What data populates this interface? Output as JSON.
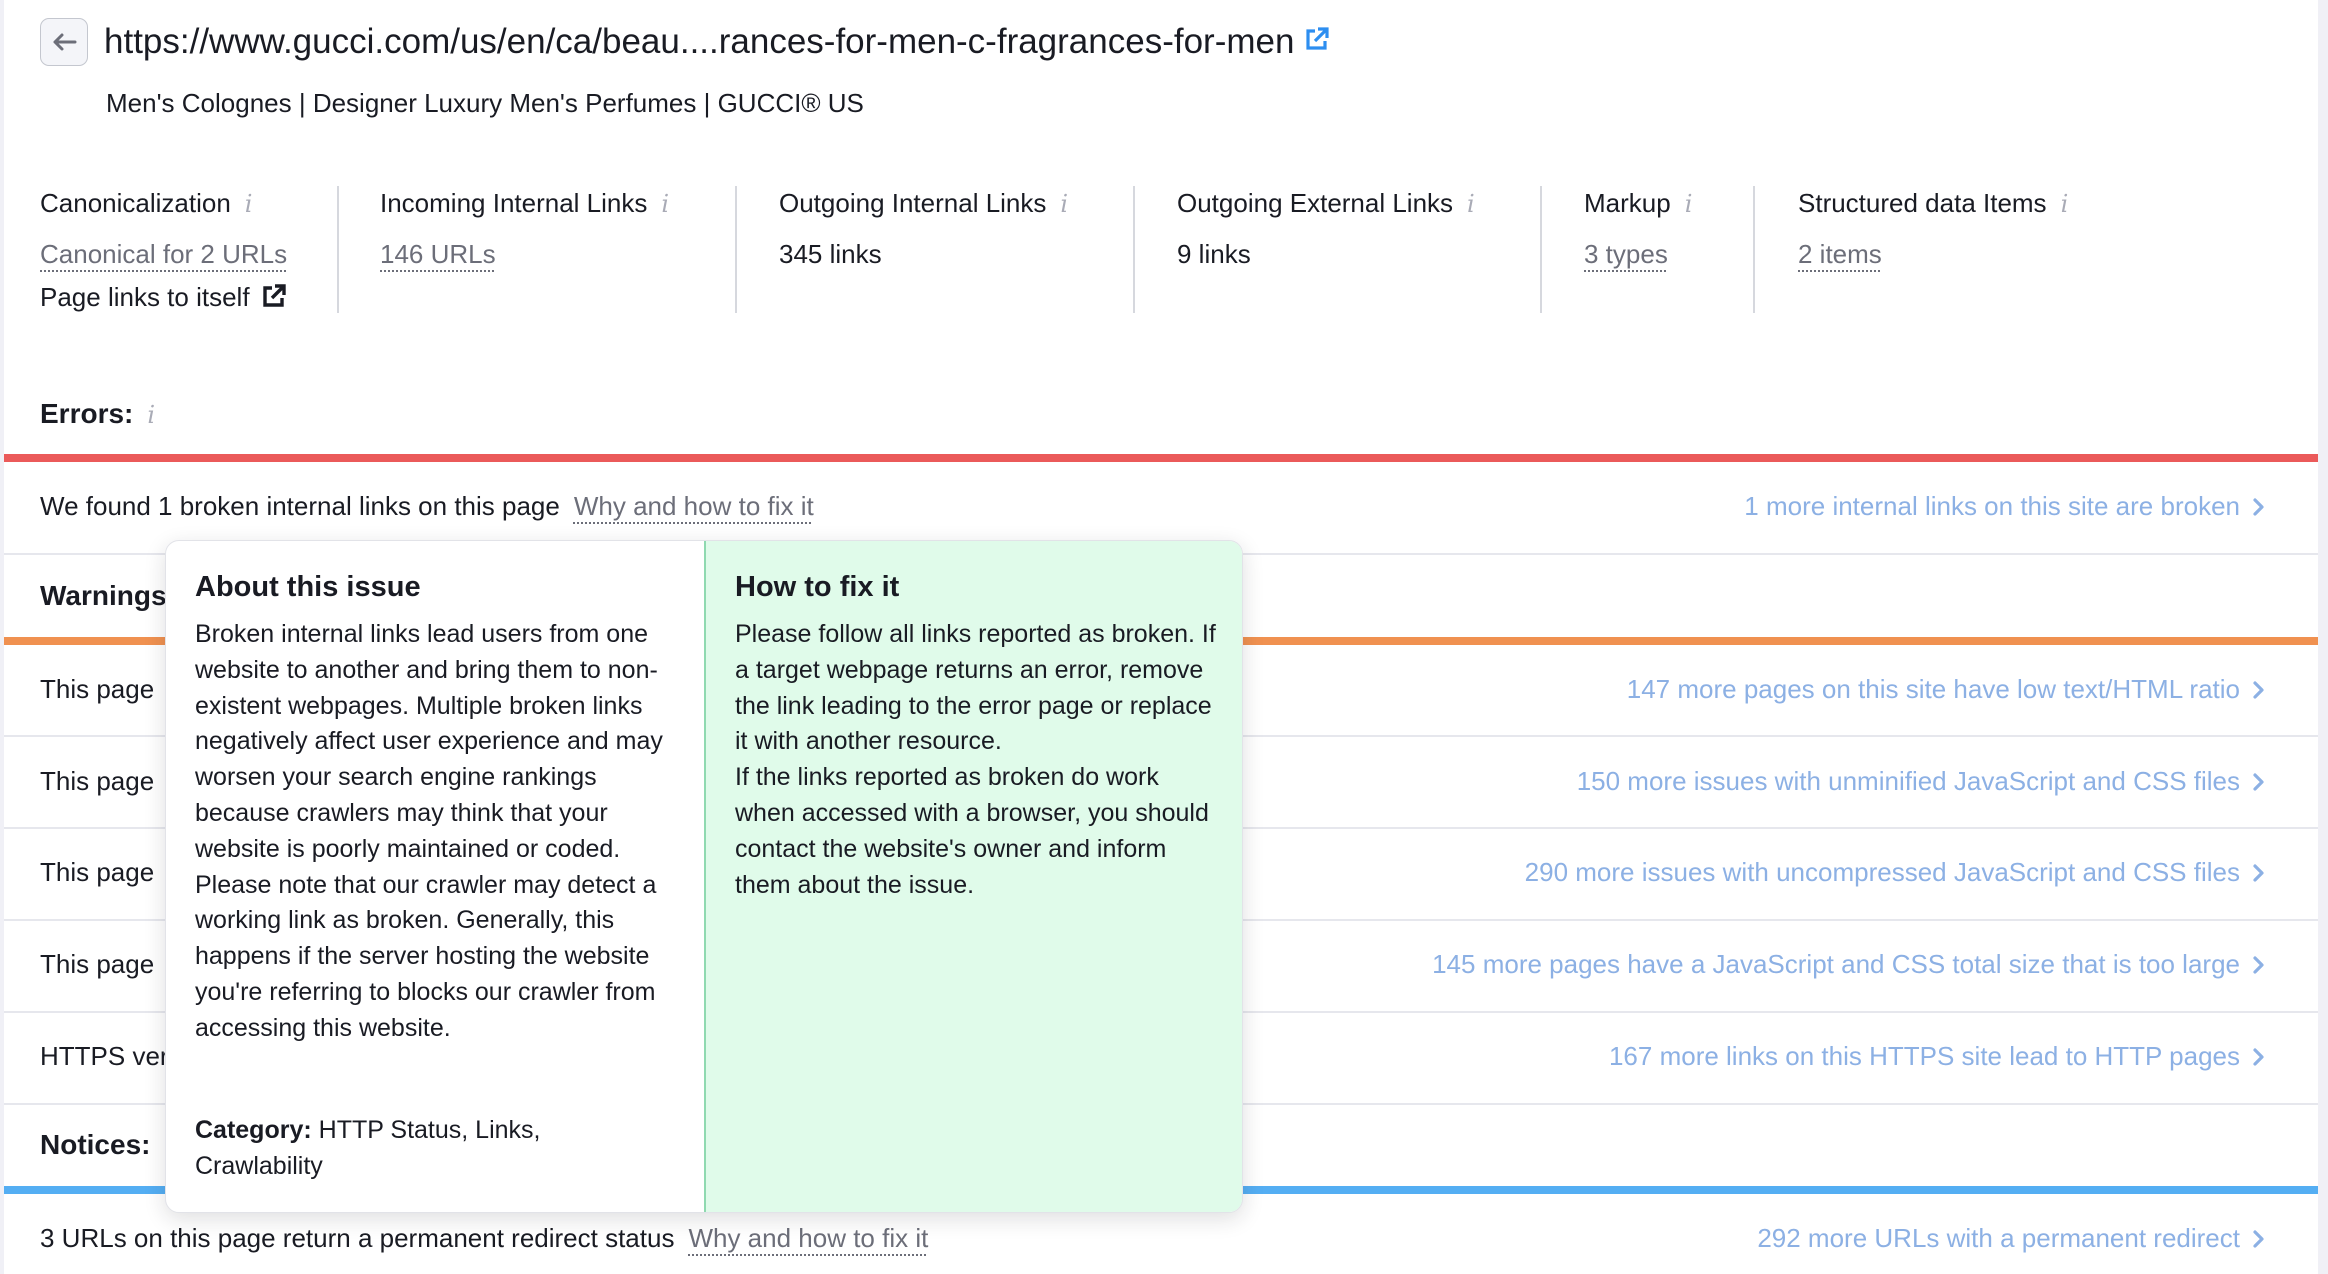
{
  "header": {
    "back_label": "Back",
    "url": "https://www.gucci.com/us/en/ca/beau....rances-for-men-c-fragrances-for-men",
    "page_title": "Men's Colognes | Designer Luxury Men's Perfumes | GUCCI® US"
  },
  "metrics": [
    {
      "label": "Canonicalization",
      "value": "Canonical for 2 URLs",
      "extra": "Page links to itself"
    },
    {
      "label": "Incoming Internal Links",
      "value": "146 URLs"
    },
    {
      "label": "Outgoing Internal Links",
      "value": "345 links"
    },
    {
      "label": "Outgoing External Links",
      "value": "9 links"
    },
    {
      "label": "Markup",
      "value": "3 types"
    },
    {
      "label": "Structured data Items",
      "value": "2 items"
    }
  ],
  "colors": {
    "errors": "#eb5a5a",
    "warnings": "#f09150",
    "notices": "#54aef3",
    "more_link": "#8cb0e4",
    "popup_fix_bg": "#e0fbea"
  },
  "errors": {
    "title": "Errors:",
    "rows": [
      {
        "text": "We found 1 broken internal links on this page",
        "fix_label": "Why and how to fix it",
        "more": "1 more internal links on this site are broken"
      }
    ]
  },
  "warnings": {
    "title": "Warnings:",
    "rows": [
      {
        "text": "This page",
        "more": "147 more pages on this site have low text/HTML ratio"
      },
      {
        "text": "This page",
        "more": "150 more issues with unminified JavaScript and CSS files"
      },
      {
        "text": "This page",
        "more": "290 more issues with uncompressed JavaScript and CSS files"
      },
      {
        "text": "This page",
        "more": "145 more pages have a JavaScript and CSS total size that is too large"
      },
      {
        "text": "HTTPS ver",
        "more": "167 more links on this HTTPS site lead to HTTP pages"
      }
    ]
  },
  "notices": {
    "title": "Notices:",
    "rows": [
      {
        "text": "3 URLs on this page return a permanent redirect status",
        "fix_label": "Why and how to fix it",
        "more": "292 more URLs with a permanent redirect"
      }
    ]
  },
  "popup": {
    "about_title": "About this issue",
    "about_paragraphs": [
      "Broken internal links lead users from one website to another and bring them to non-existent webpages. Multiple broken links negatively affect user experience and may worsen your search engine rankings because crawlers may think that your website is poorly maintained or coded.",
      "Please note that our crawler may detect a working link as broken. Generally, this happens if the server hosting the website you're referring to blocks our crawler from accessing this website."
    ],
    "category_label": "Category:",
    "category_value": "HTTP Status, Links, Crawlability",
    "fix_title": "How to fix it",
    "fix_paragraphs": [
      "Please follow all links reported as broken. If a target webpage returns an error, remove the link leading to the error page or replace it with another resource.",
      "If the links reported as broken do work when accessed with a browser, you should contact the website's owner and inform them about the issue."
    ]
  }
}
